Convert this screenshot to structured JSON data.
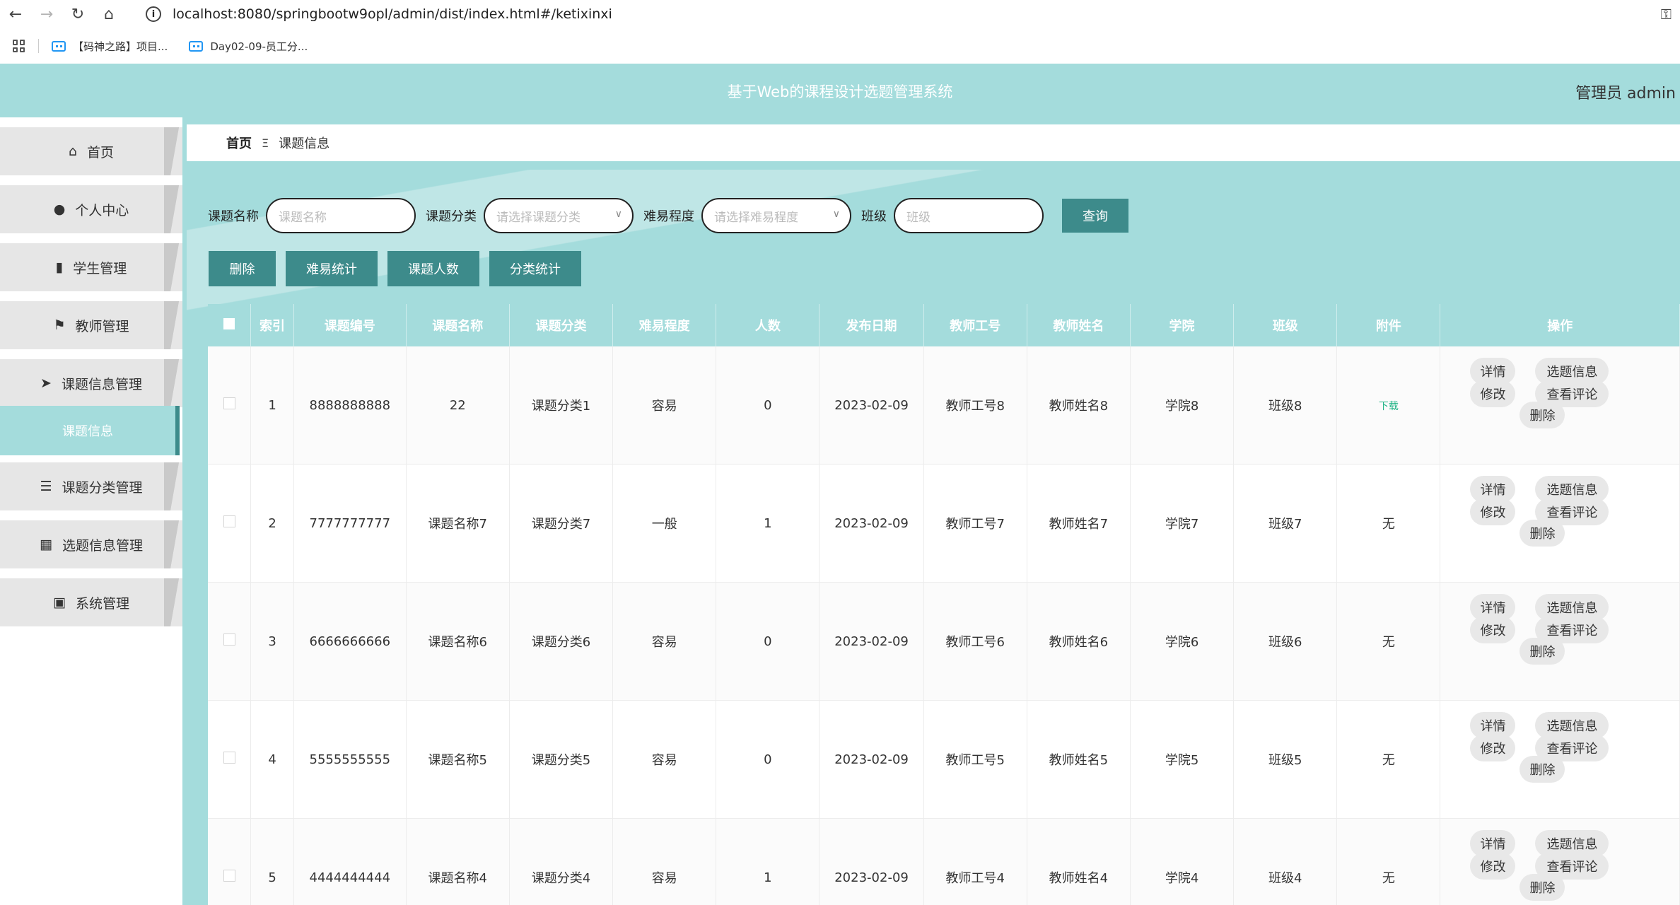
{
  "browser": {
    "url": "localhost:8080/springbootw9opl/admin/dist/index.html#/ketixinxi",
    "bookmarks": [
      "【码神之路】项目...",
      "Day02-09-员工分..."
    ]
  },
  "header": {
    "title": "基于Web的课程设计选题管理系统",
    "user": "管理员 admin"
  },
  "sidebar": {
    "items": [
      {
        "label": "首页",
        "icon": "home-icon",
        "glyph": "⌂"
      },
      {
        "label": "个人中心",
        "icon": "user-icon",
        "glyph": "●"
      },
      {
        "label": "学生管理",
        "icon": "book-icon",
        "glyph": "▮"
      },
      {
        "label": "教师管理",
        "icon": "flag-icon",
        "glyph": "⚑"
      },
      {
        "label": "课题信息管理",
        "icon": "send-icon",
        "glyph": "➤"
      },
      {
        "label": "课题分类管理",
        "icon": "list-icon",
        "glyph": "☰"
      },
      {
        "label": "选题信息管理",
        "icon": "grid-icon",
        "glyph": "▦"
      },
      {
        "label": "系统管理",
        "icon": "clipboard-icon",
        "glyph": "▣"
      }
    ],
    "active_sub": "课题信息"
  },
  "breadcrumb": {
    "home": "首页",
    "sep": "Ξ",
    "current": "课题信息"
  },
  "search": {
    "name_label": "课题名称",
    "name_placeholder": "课题名称",
    "category_label": "课题分类",
    "category_placeholder": "请选择课题分类",
    "difficulty_label": "难易程度",
    "difficulty_placeholder": "请选择难易程度",
    "class_label": "班级",
    "class_placeholder": "班级",
    "query": "查询"
  },
  "actions": [
    "删除",
    "难易统计",
    "课题人数",
    "分类统计"
  ],
  "table": {
    "headers": [
      "索引",
      "课题编号",
      "课题名称",
      "课题分类",
      "难易程度",
      "人数",
      "发布日期",
      "教师工号",
      "教师姓名",
      "学院",
      "班级",
      "附件",
      "操作"
    ],
    "rows": [
      [
        "1",
        "8888888888",
        "22",
        "课题分类1",
        "容易",
        "0",
        "2023-02-09",
        "教师工号8",
        "教师姓名8",
        "学院8",
        "班级8",
        "下载"
      ],
      [
        "2",
        "7777777777",
        "课题名称7",
        "课题分类7",
        "一般",
        "1",
        "2023-02-09",
        "教师工号7",
        "教师姓名7",
        "学院7",
        "班级7",
        "无"
      ],
      [
        "3",
        "6666666666",
        "课题名称6",
        "课题分类6",
        "容易",
        "0",
        "2023-02-09",
        "教师工号6",
        "教师姓名6",
        "学院6",
        "班级6",
        "无"
      ],
      [
        "4",
        "5555555555",
        "课题名称5",
        "课题分类5",
        "容易",
        "0",
        "2023-02-09",
        "教师工号5",
        "教师姓名5",
        "学院5",
        "班级5",
        "无"
      ],
      [
        "5",
        "4444444444",
        "课题名称4",
        "课题分类4",
        "容易",
        "1",
        "2023-02-09",
        "教师工号4",
        "教师姓名4",
        "学院4",
        "班级4",
        "无"
      ]
    ],
    "ops": [
      "详情",
      "选题信息",
      "修改",
      "查看评论",
      "删除"
    ]
  },
  "colors": {
    "primary": "#a4dcdc",
    "dark": "#3d8b8b"
  }
}
